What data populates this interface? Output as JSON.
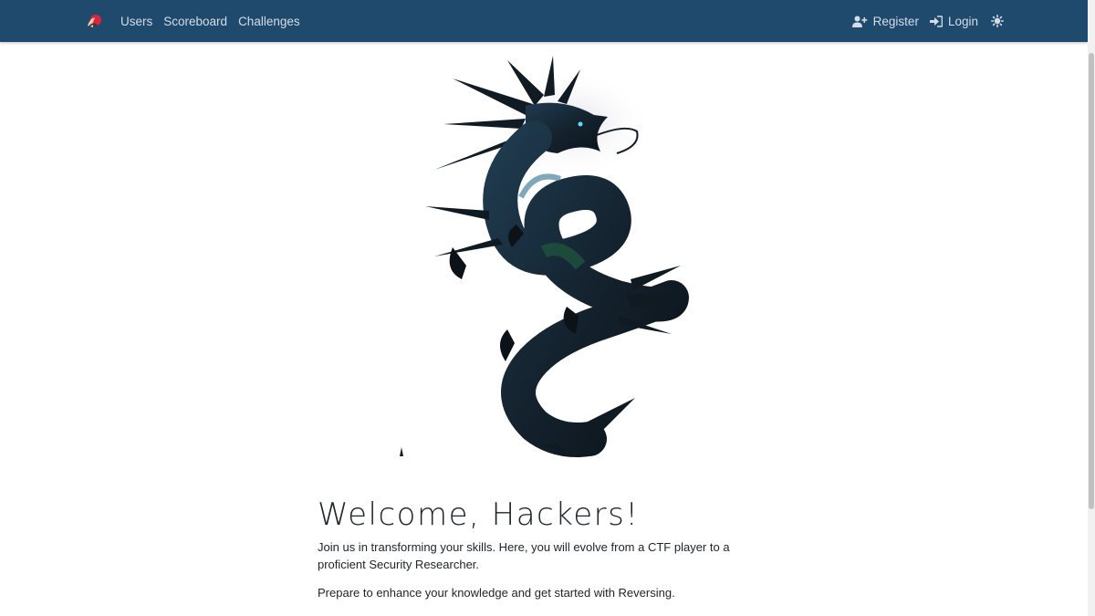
{
  "nav": {
    "links": [
      "Users",
      "Scoreboard",
      "Challenges"
    ],
    "register_label": "Register",
    "login_label": "Login"
  },
  "main": {
    "title": "Welcome, Hackers!",
    "intro": "Join us in transforming your skills. Here, you will evolve from a CTF player to a proficient Security Researcher.",
    "cta": "Prepare to enhance your knowledge and get started with Reversing."
  },
  "colors": {
    "navbar": "#1f4a6e",
    "nav_text": "#d4dde6",
    "body_text": "#212529"
  },
  "icons": {
    "brand": "dragon-logo-icon",
    "register": "user-plus-icon",
    "login": "sign-in-icon",
    "theme": "sun-icon"
  }
}
